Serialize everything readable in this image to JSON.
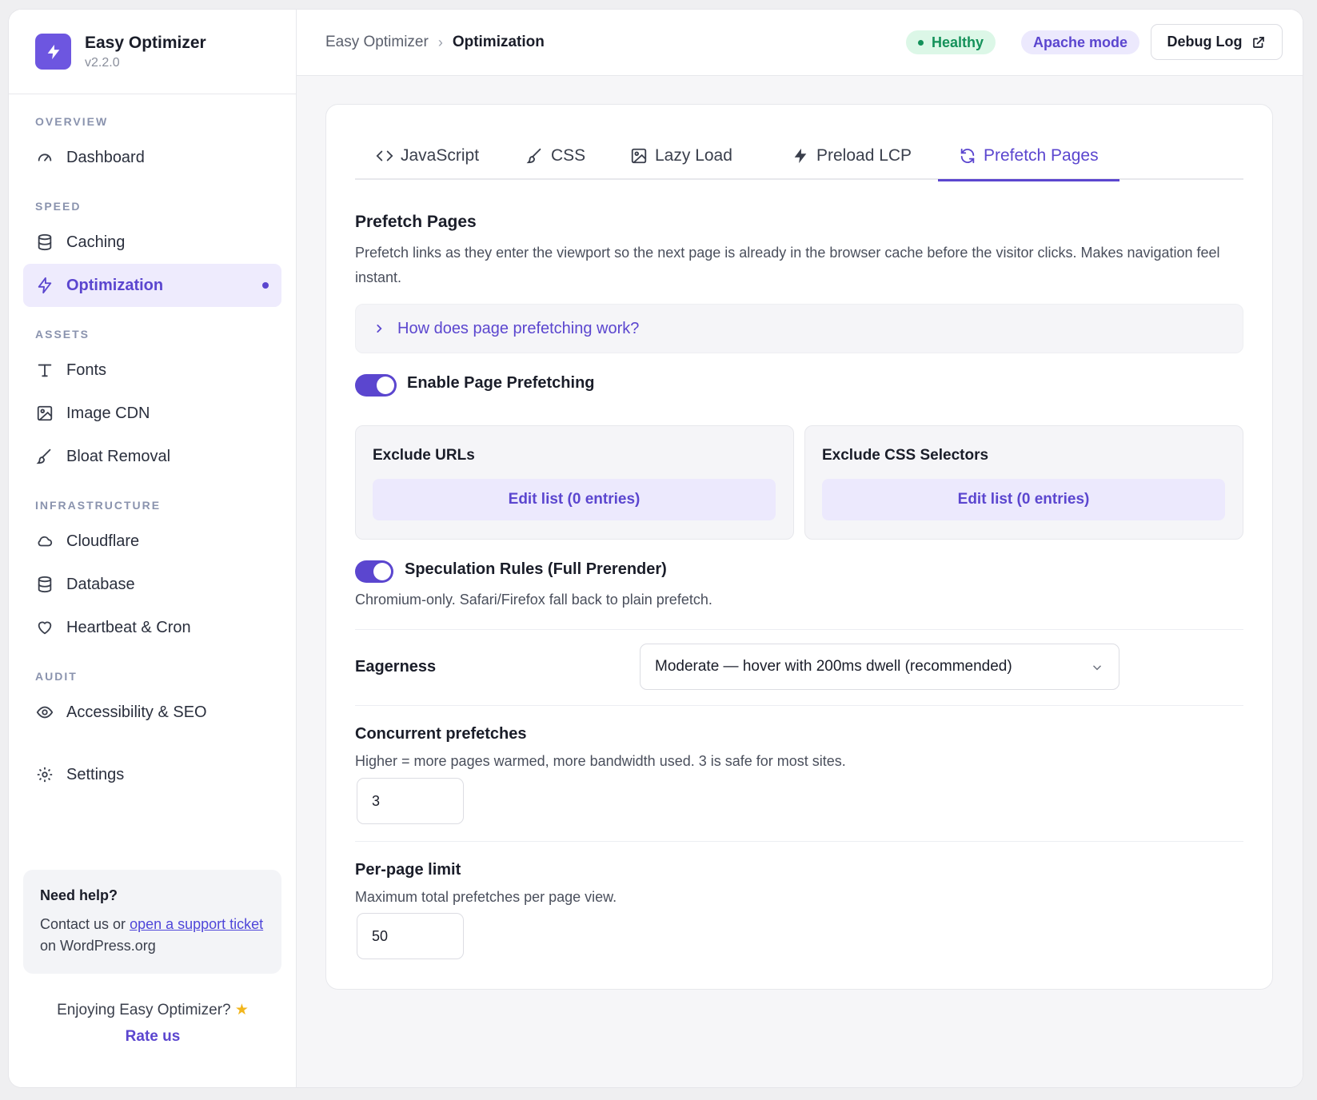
{
  "brand": {
    "name": "Easy Optimizer",
    "version": "v2.2.0",
    "accent": "#6d56e0"
  },
  "sidebar": {
    "sections": [
      {
        "label": "OVERVIEW",
        "items": [
          {
            "label": "Dashboard",
            "icon": "gauge-icon"
          }
        ]
      },
      {
        "label": "SPEED",
        "items": [
          {
            "label": "Caching",
            "icon": "database-icon"
          },
          {
            "label": "Optimization",
            "icon": "bolt-icon",
            "active": true
          }
        ]
      },
      {
        "label": "ASSETS",
        "items": [
          {
            "label": "Fonts",
            "icon": "type-icon"
          },
          {
            "label": "Image CDN",
            "icon": "image-icon"
          },
          {
            "label": "Bloat Removal",
            "icon": "brush-icon"
          }
        ]
      },
      {
        "label": "INFRASTRUCTURE",
        "items": [
          {
            "label": "Cloudflare",
            "icon": "cloud-icon"
          },
          {
            "label": "Database",
            "icon": "database-icon"
          },
          {
            "label": "Heartbeat & Cron",
            "icon": "heart-icon"
          }
        ]
      },
      {
        "label": "AUDIT",
        "items": [
          {
            "label": "Accessibility & SEO",
            "icon": "eye-icon"
          }
        ]
      }
    ],
    "settings_label": "Settings",
    "help": {
      "title": "Need help?",
      "text_before": "Contact us or ",
      "link": "open a support ticket",
      "text_after": " on WordPress.org"
    },
    "enjoy": "Enjoying Easy Optimizer?",
    "rate": "Rate us"
  },
  "topbar": {
    "breadcrumb_root": "Easy Optimizer",
    "breadcrumb_sep": "›",
    "breadcrumb_current": "Optimization",
    "status_badge": "Healthy",
    "mode_badge": "Apache mode",
    "debug_button": "Debug Log"
  },
  "tabs": [
    {
      "label": "JavaScript",
      "icon": "code-icon"
    },
    {
      "label": "CSS",
      "icon": "brush-icon"
    },
    {
      "label": "Lazy Load",
      "icon": "image-icon"
    },
    {
      "label": "Preload LCP",
      "icon": "bolt-icon"
    },
    {
      "label": "Prefetch Pages",
      "icon": "refresh-icon",
      "active": true
    }
  ],
  "prefetch": {
    "title": "Prefetch Pages",
    "description": "Prefetch links as they enter the viewport so the next page is already in the browser cache before the visitor clicks. Makes navigation feel instant.",
    "faq": "How does page prefetching work?",
    "enable_toggle": {
      "label": "Enable Page Prefetching",
      "on": true
    },
    "exclude_urls": {
      "title": "Exclude URLs",
      "button": "Edit list (0 entries)"
    },
    "exclude_css": {
      "title": "Exclude CSS Selectors",
      "button": "Edit list (0 entries)"
    },
    "speculation_toggle": {
      "label": "Speculation Rules (Full Prerender)",
      "on": true,
      "description": "Chromium-only. Safari/Firefox fall back to plain prefetch."
    },
    "eagerness": {
      "label": "Eagerness",
      "selected": "Moderate — hover with 200ms dwell (recommended)"
    },
    "concurrent": {
      "label": "Concurrent prefetches",
      "description": "Higher = more pages warmed, more bandwidth used. 3 is safe for most sites.",
      "value": "3"
    },
    "per_page": {
      "label": "Per-page limit",
      "description": "Maximum total prefetches per page view.",
      "value": "50"
    }
  }
}
